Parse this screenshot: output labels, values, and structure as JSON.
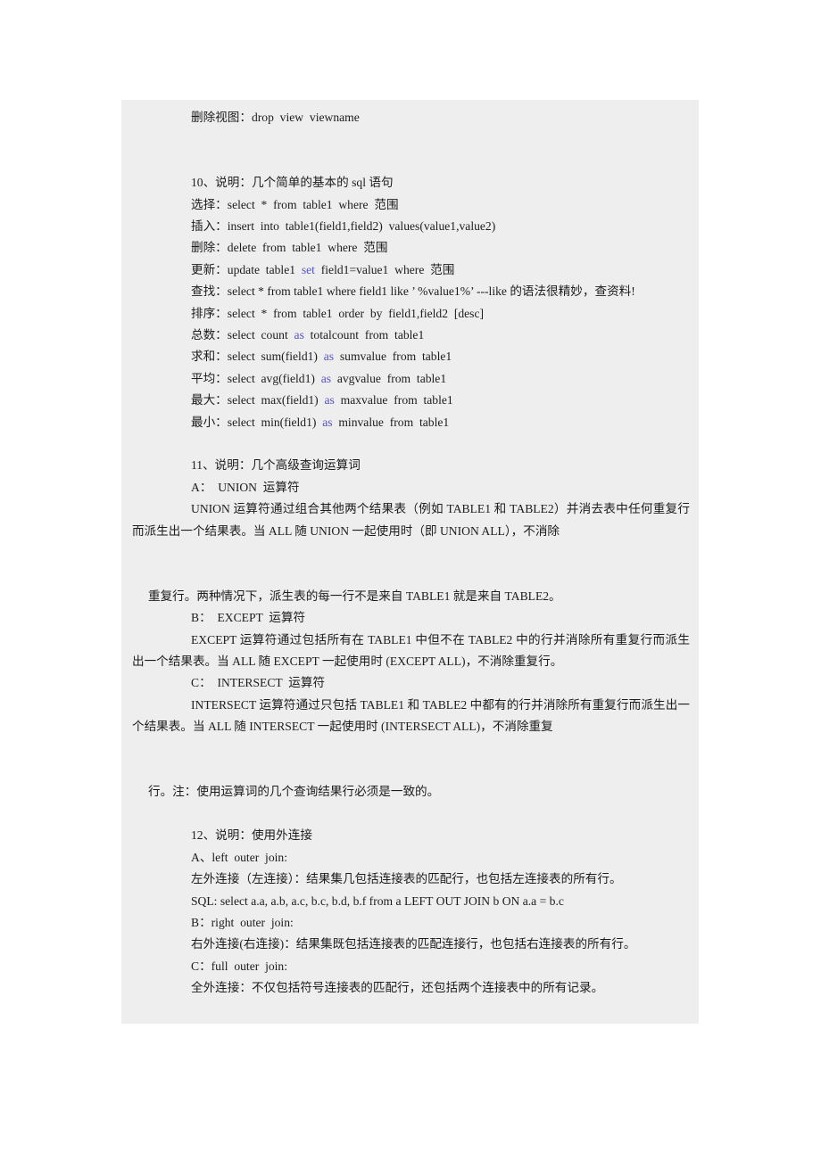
{
  "page": {
    "background": "#ffffff",
    "block_background": "#eeeeee",
    "text_color": "#1c1c1c",
    "keyword_color": "#5555c4"
  },
  "doc": {
    "lines": [
      {
        "id": "drop-view",
        "kind": "indent",
        "text": "删除视图：drop  view  viewname"
      },
      {
        "id": "gap-1",
        "kind": "blank",
        "text": ""
      },
      {
        "id": "gap-1b",
        "kind": "blank",
        "text": ""
      },
      {
        "id": "heading-10",
        "kind": "indent",
        "text": "10、说明：几个简单的基本的 sql 语句"
      },
      {
        "id": "select-line",
        "kind": "indent",
        "text": "选择：select  *  from  table1  where  范围"
      },
      {
        "id": "insert-line",
        "kind": "indent",
        "text": "插入：insert  into  table1(field1,field2)  values(value1,value2)"
      },
      {
        "id": "delete-line",
        "kind": "indent",
        "text": "删除：delete  from  table1  where  范围"
      },
      {
        "id": "update-line",
        "kind": "indent-kw",
        "prefix": "更新：update  table1  ",
        "keyword": "set",
        "suffix": "  field1=value1  where  范围"
      },
      {
        "id": "find-line",
        "kind": "para",
        "text": "查找：select  *  from  table1  where  field1  like  ’ %value1%’   ---like 的语法很精妙，查资料!"
      },
      {
        "id": "order-line",
        "kind": "indent",
        "text": "排序：select  *  from  table1  order  by  field1,field2  [desc]"
      },
      {
        "id": "count-line",
        "kind": "indent-kw",
        "prefix": "总数：select  count  ",
        "keyword": "as",
        "suffix": "  totalcount  from  table1"
      },
      {
        "id": "sum-line",
        "kind": "indent-kw",
        "prefix": "求和：select  sum(field1)  ",
        "keyword": "as",
        "suffix": "  sumvalue  from  table1"
      },
      {
        "id": "avg-line",
        "kind": "indent-kw",
        "prefix": "平均：select  avg(field1)  ",
        "keyword": "as",
        "suffix": "  avgvalue  from  table1"
      },
      {
        "id": "max-line",
        "kind": "indent-kw",
        "prefix": "最大：select  max(field1)  ",
        "keyword": "as",
        "suffix": "  maxvalue  from  table1"
      },
      {
        "id": "min-line",
        "kind": "indent-kw",
        "prefix": "最小：select  min(field1)  ",
        "keyword": "as",
        "suffix": "  minvalue  from  table1"
      },
      {
        "id": "gap-2",
        "kind": "blank",
        "text": ""
      },
      {
        "id": "heading-11",
        "kind": "indent",
        "text": "11、说明：几个高级查询运算词"
      },
      {
        "id": "union-label",
        "kind": "indent",
        "text": "A：  UNION  运算符"
      },
      {
        "id": "union-desc",
        "kind": "para",
        "text": "UNION  运算符通过组合其他两个结果表（例如  TABLE1  和  TABLE2）并消去表中任何重复行而派生出一个结果表。当  ALL  随  UNION  一起使用时（即  UNION  ALL），不消除"
      },
      {
        "id": "gap-3",
        "kind": "blank",
        "text": ""
      },
      {
        "id": "gap-3b",
        "kind": "blank",
        "text": ""
      },
      {
        "id": "union-desc2",
        "kind": "para-small",
        "text": "重复行。两种情况下，派生表的每一行不是来自  TABLE1  就是来自  TABLE2。"
      },
      {
        "id": "except-label",
        "kind": "indent",
        "text": "B：  EXCEPT  运算符"
      },
      {
        "id": "except-desc",
        "kind": "para",
        "text": "EXCEPT  运算符通过包括所有在  TABLE1  中但不在  TABLE2  中的行并消除所有重复行而派生出一个结果表。当  ALL  随  EXCEPT  一起使用时  (EXCEPT  ALL)，不消除重复行。"
      },
      {
        "id": "intersect-label",
        "kind": "indent",
        "text": "C：  INTERSECT  运算符"
      },
      {
        "id": "intersect-desc",
        "kind": "para",
        "text": "INTERSECT  运算符通过只包括  TABLE1  和  TABLE2  中都有的行并消除所有重复行而派生出一个结果表。当  ALL  随  INTERSECT  一起使用时  (INTERSECT  ALL)，不消除重复"
      },
      {
        "id": "gap-4",
        "kind": "blank",
        "text": ""
      },
      {
        "id": "gap-4b",
        "kind": "blank",
        "text": ""
      },
      {
        "id": "note-line",
        "kind": "para-small",
        "text": "行。注：使用运算词的几个查询结果行必须是一致的。"
      },
      {
        "id": "gap-5",
        "kind": "blank",
        "text": ""
      },
      {
        "id": "heading-12",
        "kind": "indent",
        "text": "12、说明：使用外连接"
      },
      {
        "id": "left-join-label",
        "kind": "indent",
        "text": "A、left  outer  join:"
      },
      {
        "id": "left-join-desc",
        "kind": "indent",
        "text": "左外连接（左连接）：结果集几包括连接表的匹配行，也包括左连接表的所有行。"
      },
      {
        "id": "left-join-sql",
        "kind": "para",
        "text": "SQL:  select  a.a,  a.b,  a.c,  b.c,  b.d,  b.f  from  a  LEFT  OUT  JOIN  b  ON  a.a  =  b.c"
      },
      {
        "id": "right-join-label",
        "kind": "indent",
        "text": "B：right  outer  join:"
      },
      {
        "id": "right-join-desc",
        "kind": "indent",
        "text": "右外连接(右连接)：结果集既包括连接表的匹配连接行，也包括右连接表的所有行。"
      },
      {
        "id": "full-join-label",
        "kind": "indent",
        "text": "C：full  outer  join:"
      },
      {
        "id": "full-join-desc",
        "kind": "indent",
        "text": "全外连接：不仅包括符号连接表的匹配行，还包括两个连接表中的所有记录。"
      }
    ]
  }
}
